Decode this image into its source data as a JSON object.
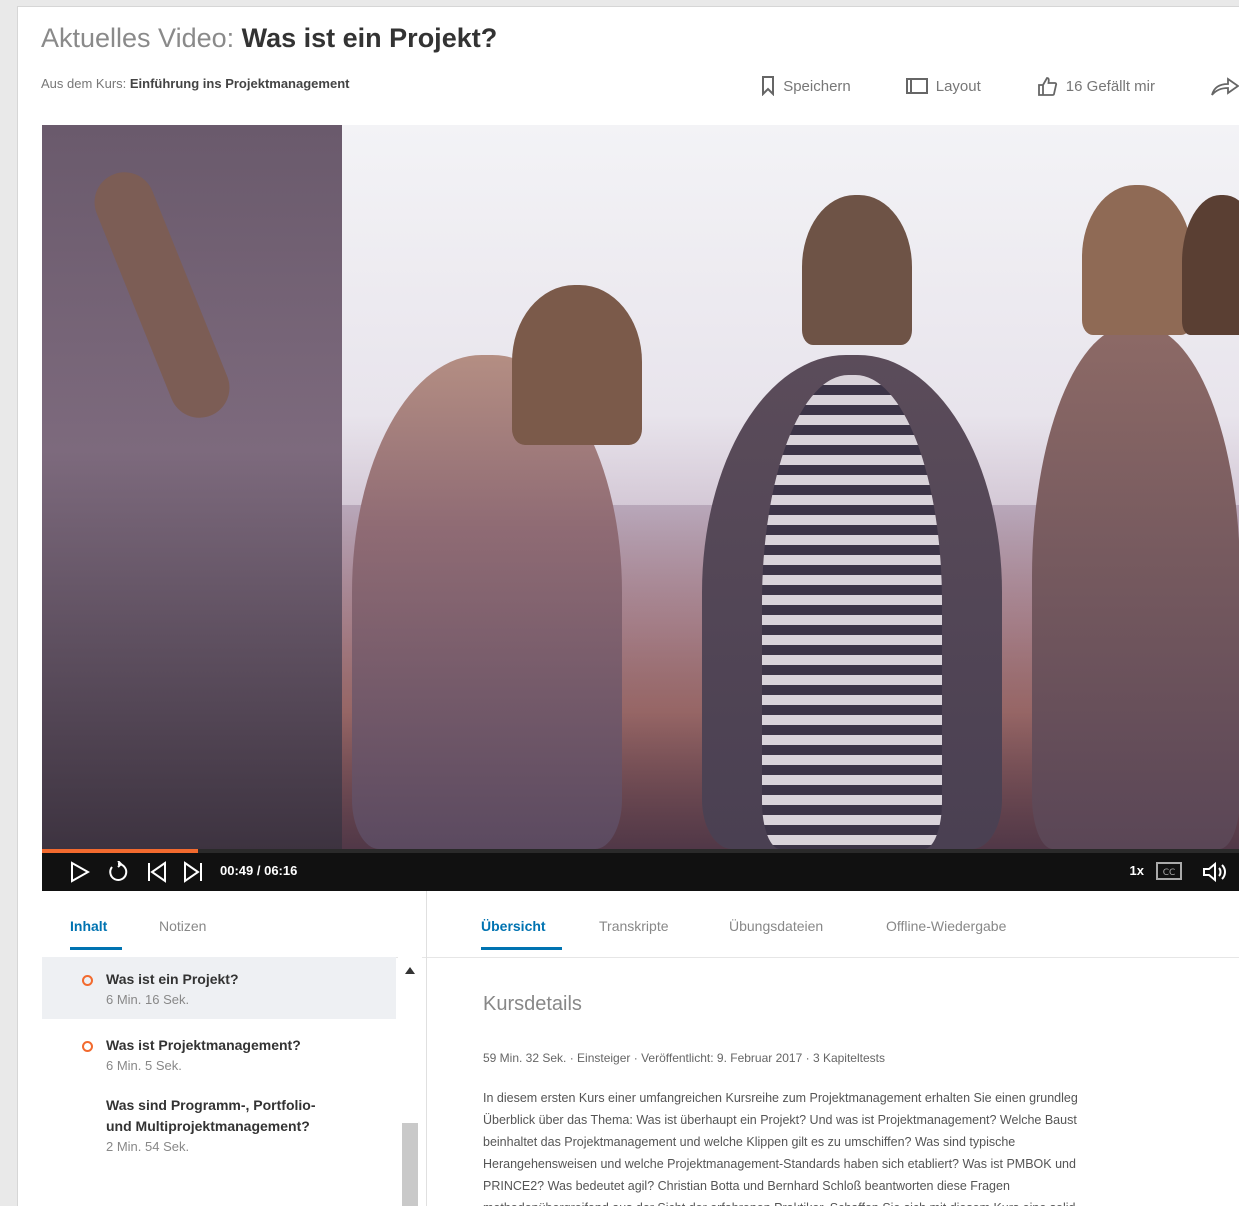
{
  "header": {
    "title_prefix": "Aktuelles Video: ",
    "title": "Was ist ein Projekt?",
    "course_prefix": "Aus dem Kurs: ",
    "course_name": "Einführung ins Projektmanagement"
  },
  "actions": {
    "save_label": "Speichern",
    "layout_label": "Layout",
    "like_label": "16 Gefällt mir"
  },
  "player": {
    "time": "00:49 / 06:16",
    "speed": "1x",
    "progress": 0.13
  },
  "left_panel": {
    "tabs": [
      "Inhalt",
      "Notizen"
    ],
    "toc": [
      {
        "title": "Was ist ein Projekt?",
        "duration": "6 Min. 16 Sek."
      },
      {
        "title": "Was ist Projektmanagement?",
        "duration": "6 Min. 5 Sek."
      },
      {
        "title_line1": "Was sind Programm-, Portfolio-",
        "title_line2": "und Multiprojektmanagement?",
        "duration": "2 Min. 54 Sek."
      }
    ]
  },
  "right_panel": {
    "tabs": [
      "Übersicht",
      "Transkripte",
      "Übungsdateien",
      "Offline-Wiedergabe"
    ],
    "heading": "Kursdetails",
    "meta": "59 Min. 32 Sek. · Einsteiger · Veröffentlicht: 9. Februar 2017 · 3 Kapiteltests",
    "description_lines": [
      "In diesem ersten Kurs einer umfangreichen Kursreihe zum Projektmanagement erhalten Sie einen grundleg",
      "Überblick über das Thema: Was ist überhaupt ein Projekt? Und was ist Projektmanagement? Welche Baust",
      "beinhaltet das Projektmanagement und welche Klippen gilt es zu umschiffen? Was sind typische",
      "Herangehensweisen und welche Projektmanagement-Standards haben sich etabliert? Was ist PMBOK und",
      "PRINCE2? Was bedeutet agil? Christian Botta und Bernhard Schloß beantworten diese Fragen",
      "methodenübergreifend aus der Sicht der erfahrenen Praktiker. Schaffen Sie sich mit diesem Kurs eine solid"
    ]
  },
  "colors": {
    "accent": "#0073b1",
    "progress": "#f26a2e"
  }
}
